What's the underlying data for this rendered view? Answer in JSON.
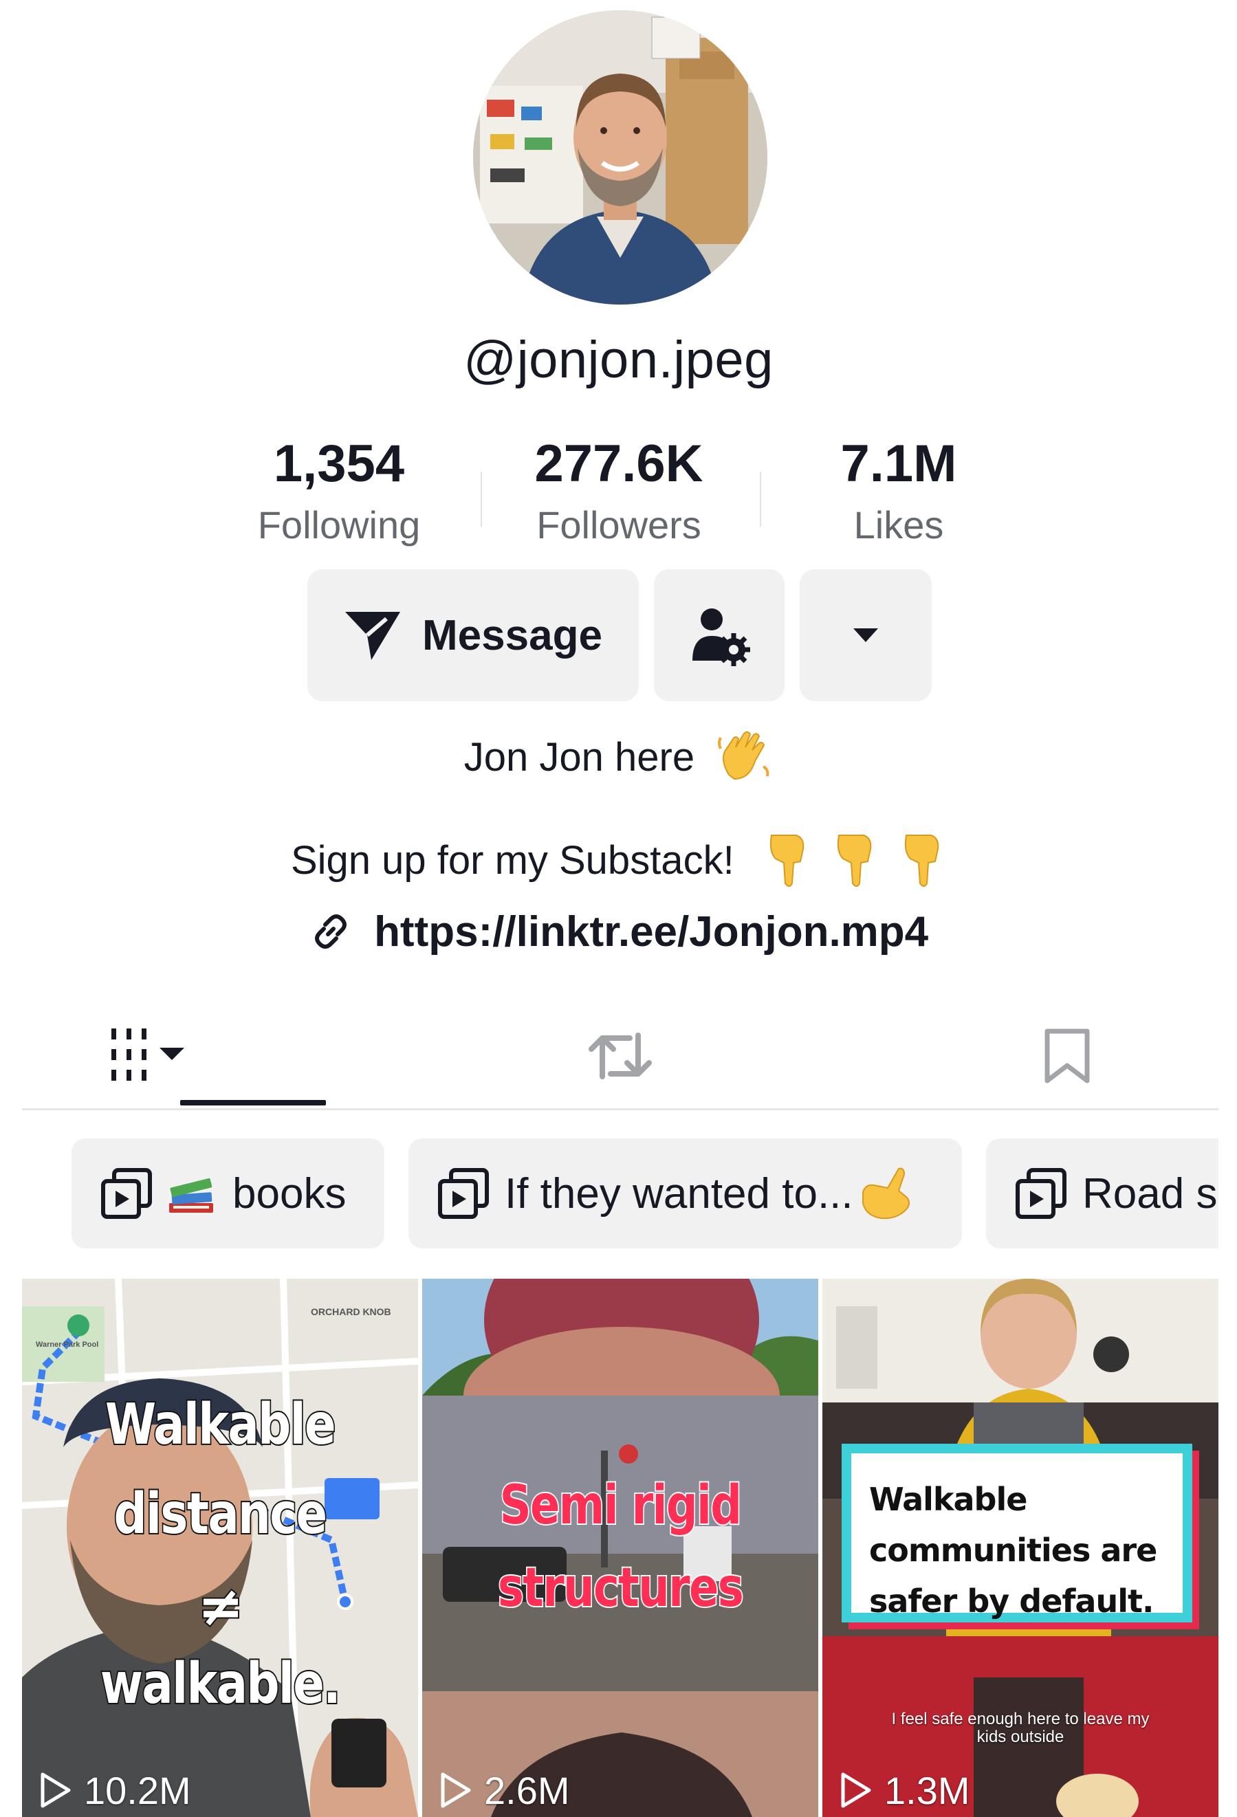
{
  "profile": {
    "username": "@jonjon.jpeg",
    "avatar_icon": "profile-photo"
  },
  "stats": [
    {
      "value": "1,354",
      "label": "Following"
    },
    {
      "value": "277.6K",
      "label": "Followers"
    },
    {
      "value": "7.1M",
      "label": "Likes"
    }
  ],
  "actions": {
    "message_label": "Message",
    "message_icon": "send-icon",
    "suggest_icon": "person-gear-icon",
    "more_icon": "caret-down-icon"
  },
  "bio": {
    "line1": "Jon Jon here",
    "line1_emoji": "waving-hand",
    "line2": "Sign up for my Substack!",
    "line2_emoji": "pointing-down x3",
    "link": "https://linktr.ee/Jonjon.mp4"
  },
  "tabs": [
    {
      "name": "videos",
      "icon": "grid-bars-icon",
      "active": true
    },
    {
      "name": "reposts",
      "icon": "repost-icon",
      "active": false
    },
    {
      "name": "saved",
      "icon": "bookmark-icon",
      "active": false
    }
  ],
  "playlists": [
    {
      "label": "books",
      "emoji": "books"
    },
    {
      "label": "If they wanted to...",
      "emoji": "call-me-hand"
    },
    {
      "label": "Road s"
    }
  ],
  "videos": [
    {
      "views": "10.2M",
      "caption": [
        "Walkable",
        "distance",
        "≠",
        "walkable."
      ],
      "map_labels": [
        "ORCHARD KNOB",
        "Warner Park Pool"
      ]
    },
    {
      "views": "2.6M",
      "caption": [
        "Semi rigid",
        "structures"
      ]
    },
    {
      "views": "1.3M",
      "caption": [
        "Walkable",
        "communities are",
        "safer by default."
      ],
      "subtitle": [
        "I feel safe enough here to leave my",
        "kids outside"
      ]
    }
  ],
  "colors": {
    "text_primary": "#161823",
    "text_secondary": "#65676e",
    "button_bg": "#f1f1f2",
    "accent_red": "#ff2e55",
    "accent_cyan": "#3ed0d8"
  }
}
